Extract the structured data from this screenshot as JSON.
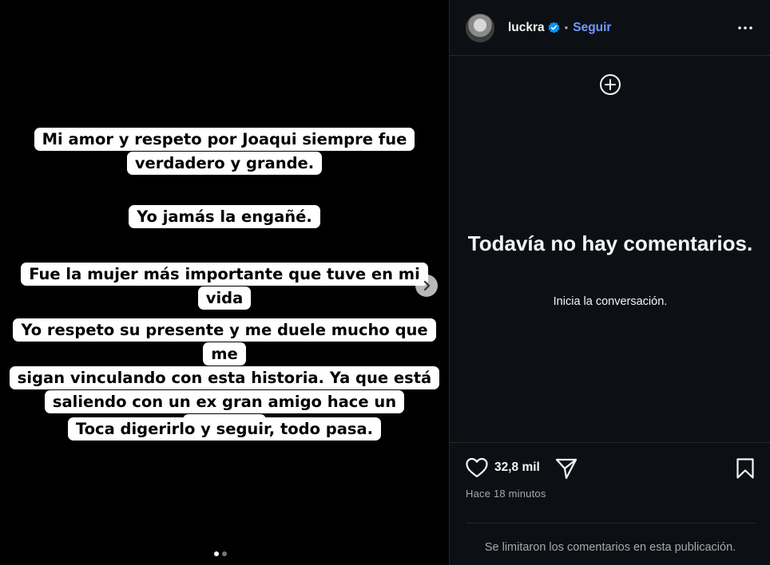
{
  "story": {
    "lines": [
      "Mi amor y respeto por Joaqui siempre fue\nverdadero y grande.",
      "Yo jamás la engañé.",
      "Fue la mujer más importante que tuve en mi vida",
      "Yo respeto su presente y me duele mucho que me\nsigan vinculando  con esta historia. Ya que está\nsaliendo con un ex gran amigo hace un tiempo.",
      "Toca digerirlo y seguir, todo pasa."
    ],
    "slide_count": 2,
    "active_slide": 1
  },
  "header": {
    "username": "luckra",
    "separator": "•",
    "follow_label": "Seguir"
  },
  "comments": {
    "empty_title": "Todavía no hay comentarios.",
    "empty_subtitle": "Inicia la conversación."
  },
  "actions": {
    "likes_count": "32,8 mil",
    "timestamp": "Hace 18 minutos"
  },
  "footer": {
    "note": "Se limitaron los comentarios en esta publicación."
  },
  "icons": [
    "chevron-right-icon",
    "verified-icon",
    "more-icon",
    "add-circle-icon",
    "heart-icon",
    "share-icon",
    "bookmark-icon"
  ],
  "colors": {
    "accent": "#6f9bff",
    "verified": "#0095f6",
    "panel_bg": "#0c1014"
  }
}
